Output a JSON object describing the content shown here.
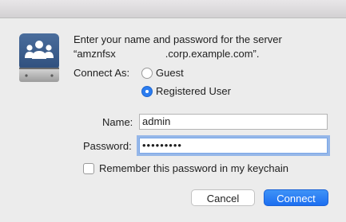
{
  "dialog": {
    "prompt_line1": "Enter your name and password for the server",
    "prompt_line2_start": "“amznfsx",
    "prompt_line2_end": ".corp.example.com”."
  },
  "connect_as": {
    "label": "Connect As:",
    "options": [
      {
        "label": "Guest",
        "selected": false
      },
      {
        "label": "Registered User",
        "selected": true
      }
    ]
  },
  "form": {
    "name_label": "Name:",
    "name_value": "admin",
    "password_label": "Password:",
    "password_mask": "•••••••••"
  },
  "remember": {
    "label": "Remember this password in my keychain",
    "checked": false
  },
  "buttons": {
    "cancel": "Cancel",
    "connect": "Connect"
  },
  "colors": {
    "accent": "#2b7cf0",
    "drive_icon": "#3a5a8a"
  },
  "icons": {
    "drive": "server-drive-icon"
  }
}
